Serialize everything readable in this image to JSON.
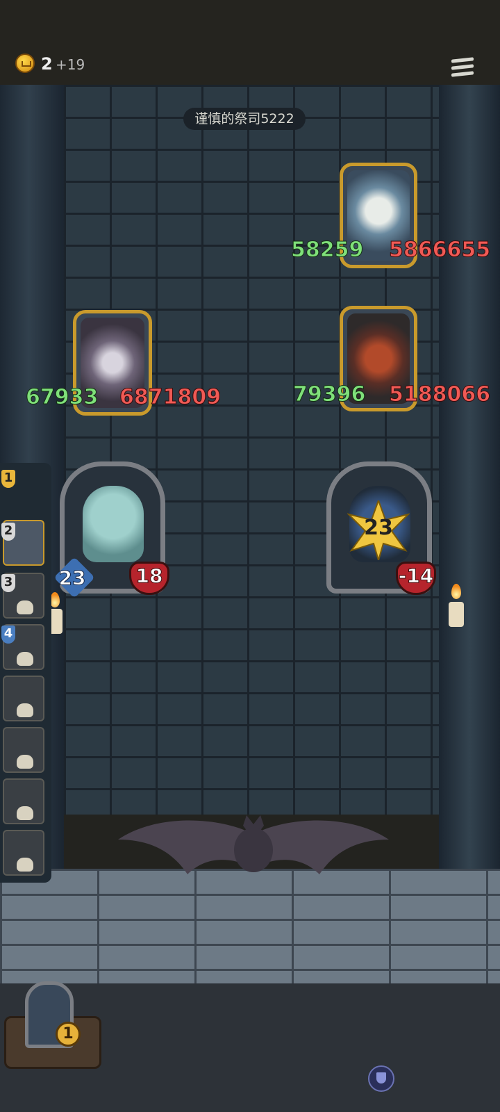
{
  "header": {
    "gold": "2",
    "gold_income": "+19"
  },
  "opponent": {
    "name": "谨慎的祭司5222"
  },
  "enemy_cards": [
    {
      "attack": "58259",
      "health": "5866655",
      "name": "white-beast-card"
    },
    {
      "attack": "67933",
      "health": "6871809",
      "name": "horned-dragon-card"
    },
    {
      "attack": "79396",
      "health": "5188066",
      "name": "red-dragon-card"
    }
  ],
  "heroes": [
    {
      "attack": "23",
      "health": "18"
    },
    {
      "burst": "23",
      "health": "-14"
    }
  ],
  "queue": {
    "slots": [
      "1",
      "2",
      "3",
      "4"
    ]
  },
  "player": {
    "level": "1"
  }
}
